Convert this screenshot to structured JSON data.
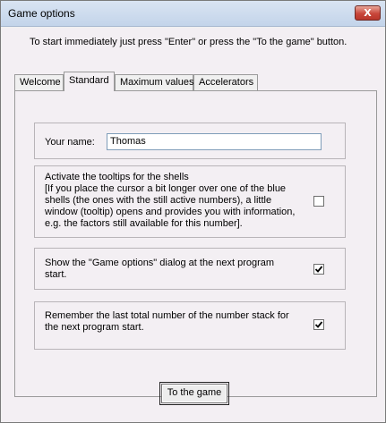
{
  "window": {
    "title": "Game options",
    "close_glyph": "X"
  },
  "instruction": "To start immediately just press \"Enter\" or press the  \"To the game\"  button.",
  "tabs": [
    {
      "label": "Welcome",
      "active": false
    },
    {
      "label": "Standard",
      "active": true
    },
    {
      "label": "Maximum values",
      "active": false
    },
    {
      "label": "Accelerators",
      "active": false
    }
  ],
  "standard": {
    "name_label": "Your name:",
    "name_value": "Thomas",
    "tooltips": {
      "lines": [
        "Activate the tooltips for the shells",
        "[If you place the cursor a bit longer over one of the blue",
        "shells (the ones with the still active numbers), a little",
        "window (tooltip) opens and provides you with information,",
        "e.g. the factors still available for this number]."
      ],
      "checked": false
    },
    "show_dialog": {
      "lines": [
        "Show the \"Game options\" dialog at the next program",
        "start."
      ],
      "checked": true
    },
    "remember_total": {
      "lines": [
        "Remember the last total number of the number stack for",
        "the next program start."
      ],
      "checked": true
    }
  },
  "footer": {
    "to_game_label": "To the game"
  }
}
